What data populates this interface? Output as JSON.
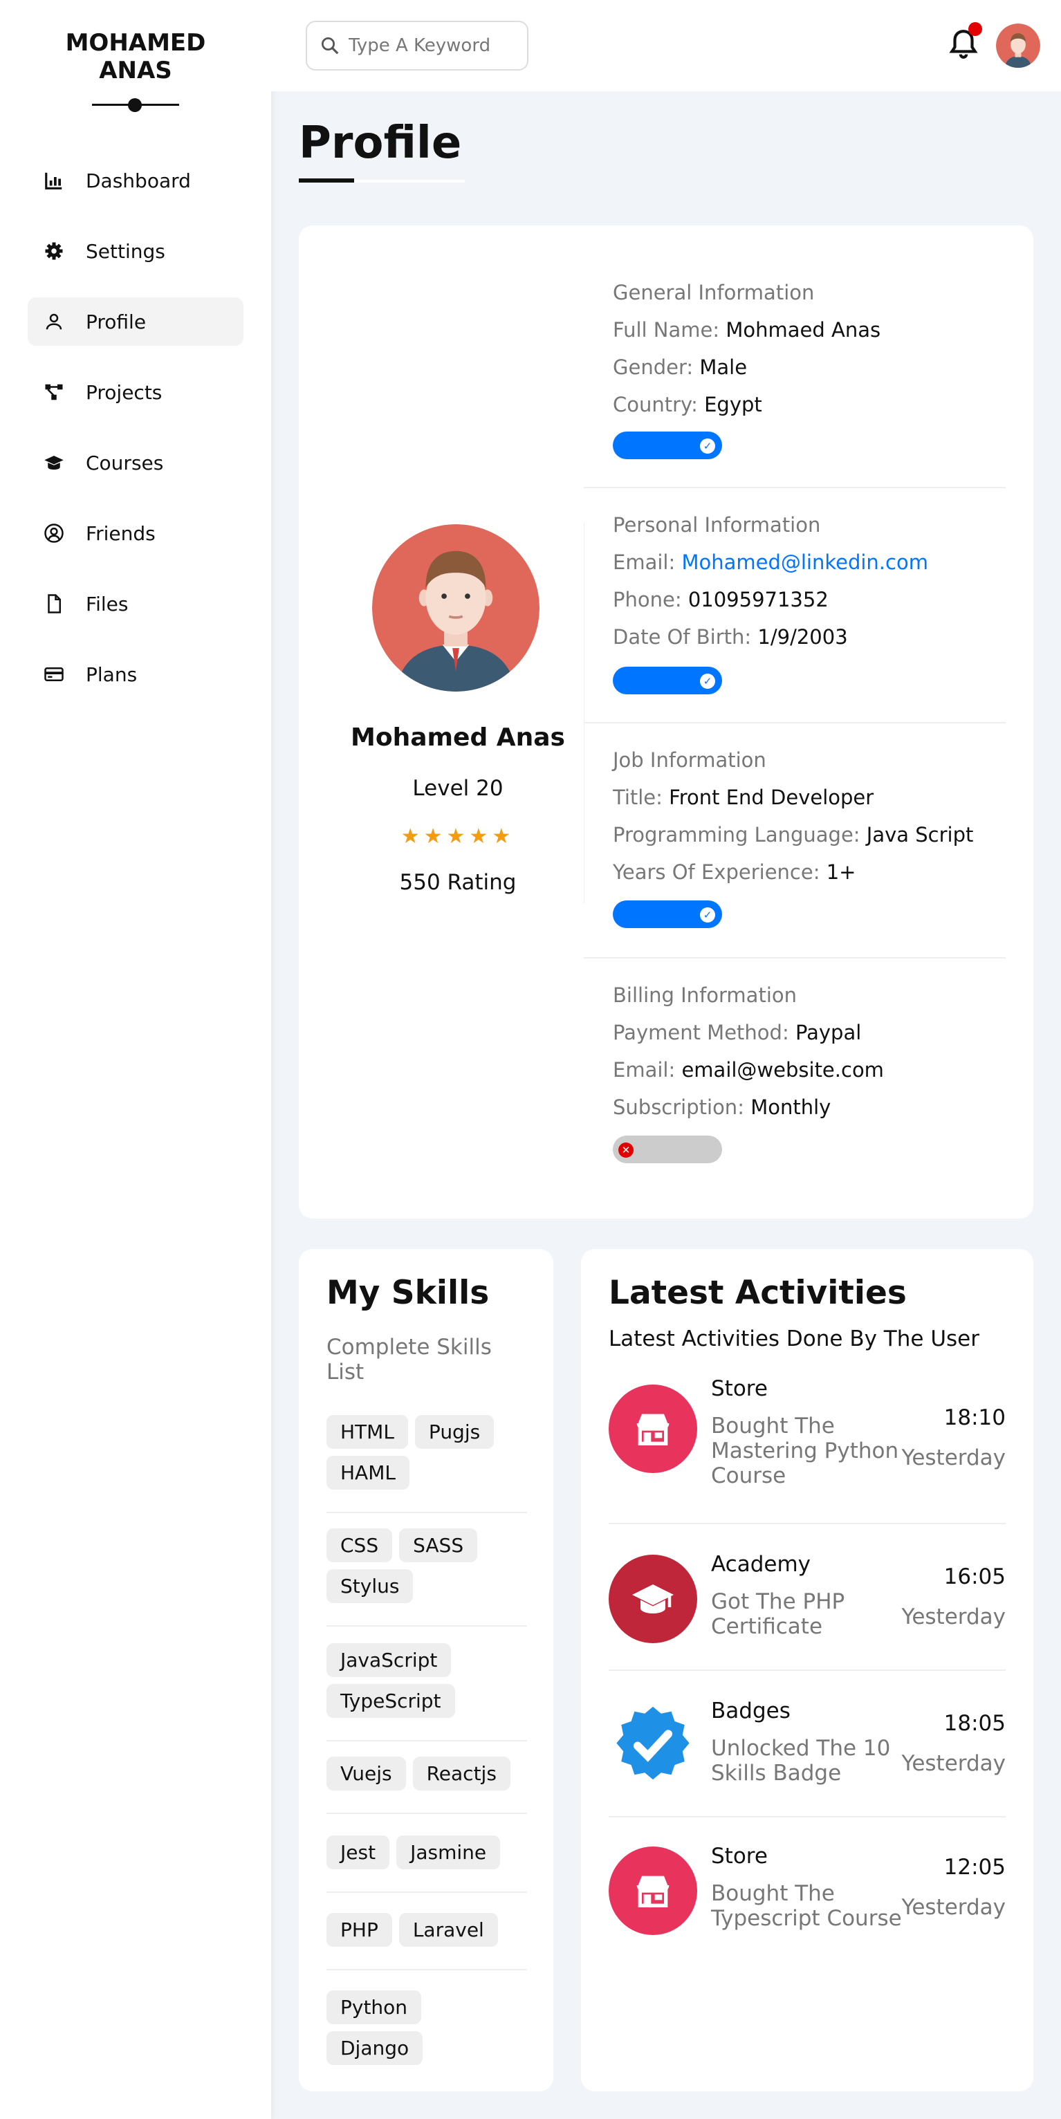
{
  "sidebar": {
    "brand_line1": "MOHAMED",
    "brand_line2": "ANAS",
    "items": [
      {
        "label": "Dashboard",
        "icon": "chart-icon"
      },
      {
        "label": "Settings",
        "icon": "gear-icon"
      },
      {
        "label": "Profile",
        "icon": "user-icon"
      },
      {
        "label": "Projects",
        "icon": "diagram-icon"
      },
      {
        "label": "Courses",
        "icon": "graduation-cap-icon"
      },
      {
        "label": "Friends",
        "icon": "user-circle-icon"
      },
      {
        "label": "Files",
        "icon": "file-icon"
      },
      {
        "label": "Plans",
        "icon": "credit-card-icon"
      }
    ]
  },
  "header": {
    "search_placeholder": "Type A Keyword"
  },
  "page": {
    "title": "Profile"
  },
  "profile": {
    "name": "Mohamed Anas",
    "level": "Level 20",
    "stars": "★★★★★",
    "rating": "550 Rating",
    "general": {
      "title": "General Information",
      "full_name_key": "Full Name:",
      "full_name": "Mohmaed Anas",
      "gender_key": "Gender:",
      "gender": "Male",
      "country_key": "Country:",
      "country": "Egypt"
    },
    "personal": {
      "title": "Personal Information",
      "email_key": "Email:",
      "email": "Mohamed@linkedin.com",
      "phone_key": "Phone:",
      "phone": "01095971352",
      "dob_key": "Date Of Birth:",
      "dob": "1/9/2003"
    },
    "job": {
      "title": "Job Information",
      "title_key": "Title:",
      "job_title": "Front End Developer",
      "lang_key": "Programming Language:",
      "lang": "Java Script",
      "years_key": "Years Of Experience:",
      "years": "1+"
    },
    "billing": {
      "title": "Billing Information",
      "method_key": "Payment Method:",
      "method": "Paypal",
      "email_key": "Email:",
      "email": "email@website.com",
      "sub_key": "Subscription:",
      "sub": "Monthly"
    },
    "toggles": {
      "general": true,
      "personal": true,
      "job": true,
      "billing": false
    }
  },
  "skills": {
    "title": "My Skills",
    "subtitle": "Complete Skills List",
    "groups": [
      [
        "HTML",
        "Pugjs",
        "HAML"
      ],
      [
        "CSS",
        "SASS",
        "Stylus"
      ],
      [
        "JavaScript",
        "TypeScript"
      ],
      [
        "Vuejs",
        "Reactjs"
      ],
      [
        "Jest",
        "Jasmine"
      ],
      [
        "PHP",
        "Laravel"
      ],
      [
        "Python",
        "Django"
      ]
    ]
  },
  "activities": {
    "title": "Latest Activities",
    "subtitle": "Latest Activities Done By The User",
    "items": [
      {
        "name": "Store",
        "desc": "Bought The Mastering Python Course",
        "time": "18:10",
        "day": "Yesterday",
        "icon": "store-icon"
      },
      {
        "name": "Academy",
        "desc": "Got The PHP Certificate",
        "time": "16:05",
        "day": "Yesterday",
        "icon": "graduation-cap-icon"
      },
      {
        "name": "Badges",
        "desc": "Unlocked The 10 Skills Badge",
        "time": "18:05",
        "day": "Yesterday",
        "icon": "badge-check-icon"
      },
      {
        "name": "Store",
        "desc": "Bought The Typescript Course",
        "time": "12:05",
        "day": "Yesterday",
        "icon": "store-icon"
      }
    ]
  },
  "colors": {
    "accent": "#0075ff",
    "star": "#f39c12",
    "notification": "#e30000"
  }
}
